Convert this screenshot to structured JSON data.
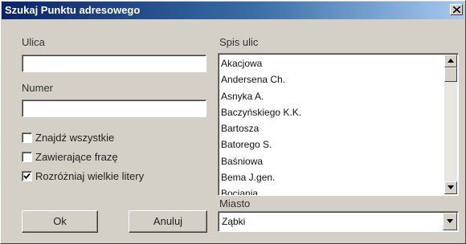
{
  "window": {
    "title": "Szukaj Punktu adresowego"
  },
  "fields": {
    "street_label": "Ulica",
    "street_value": "",
    "number_label": "Numer",
    "number_value": ""
  },
  "options": [
    {
      "label": "Znajdź wszystkie",
      "checked": false
    },
    {
      "label": "Zawierające frazę",
      "checked": false
    },
    {
      "label": "Rozróżniaj wielkie litery",
      "checked": true
    }
  ],
  "buttons": {
    "ok": "Ok",
    "cancel": "Anuluj"
  },
  "street_list": {
    "label": "Spis ulic",
    "items": [
      "Akacjowa",
      "Andersena Ch.",
      "Asnyka A.",
      "Baczyńskiego K.K.",
      "Bartosza",
      "Batorego S.",
      "Baśniowa",
      "Bema J.gen.",
      "Bociania"
    ]
  },
  "city": {
    "label": "Miasto",
    "value": "Ząbki"
  },
  "icons": {
    "close": "close-icon",
    "scroll_up": "arrow-up-icon",
    "scroll_down": "arrow-down-icon",
    "dropdown": "chevron-down-icon",
    "check": "checkmark-icon"
  }
}
